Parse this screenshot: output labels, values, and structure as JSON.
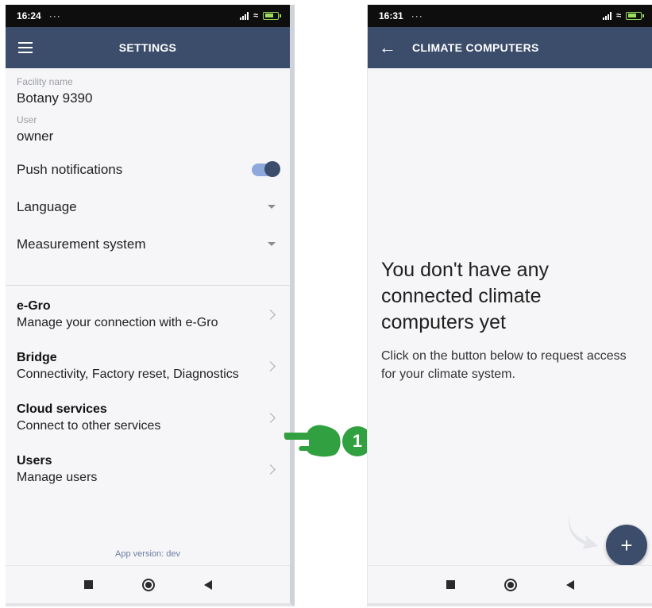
{
  "left_screen": {
    "status_time": "16:24",
    "status_dots": "···",
    "appbar_title": "SETTINGS",
    "facility_label": "Facility name",
    "facility_value": "Botany 9390",
    "user_label": "User",
    "user_value": "owner",
    "push_label": "Push notifications",
    "push_enabled": true,
    "language_label": "Language",
    "measurement_label": "Measurement system",
    "nav_items": [
      {
        "title": "e-Gro",
        "subtitle": "Manage your connection with e-Gro"
      },
      {
        "title": "Bridge",
        "subtitle": "Connectivity, Factory reset, Diagnostics"
      },
      {
        "title": "Cloud services",
        "subtitle": "Connect to other services"
      },
      {
        "title": "Users",
        "subtitle": "Manage users"
      }
    ],
    "app_version": "App version: dev"
  },
  "right_screen": {
    "status_time": "16:31",
    "status_dots": "···",
    "appbar_title": "CLIMATE COMPUTERS",
    "empty_title": "You don't have any connected climate computers yet",
    "empty_desc": "Click on the button below to request access for your climate system.",
    "fab_label": "+"
  },
  "annotation": {
    "step_number": "1"
  },
  "colors": {
    "appbar": "#3c4d6b",
    "toggle_track": "#8fa8db",
    "annotation_green": "#31a040"
  }
}
